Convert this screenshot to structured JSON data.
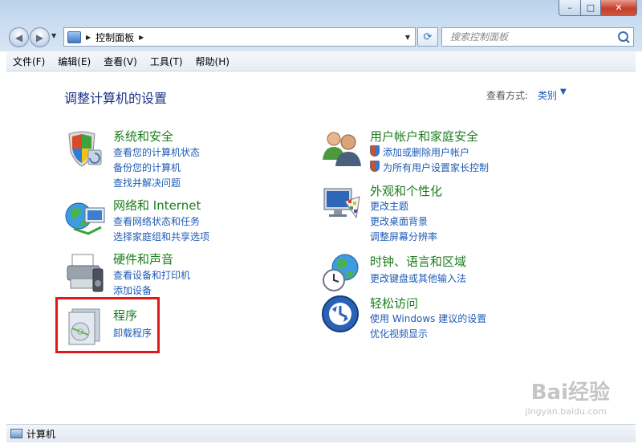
{
  "window": {
    "caption": {
      "minimize": "–",
      "maximize": "□",
      "close": "✕"
    }
  },
  "nav": {
    "back_glyph": "◀",
    "forward_glyph": "▶"
  },
  "address": {
    "path": "控制面板",
    "refresh_glyph": "⟳"
  },
  "search": {
    "placeholder": "搜索控制面板"
  },
  "menu": [
    "文件(F)",
    "编辑(E)",
    "查看(V)",
    "工具(T)",
    "帮助(H)"
  ],
  "main": {
    "title": "调整计算机的设置",
    "view_by_label": "查看方式:",
    "view_by_value": "类别"
  },
  "categories": [
    {
      "title": "系统和安全",
      "icon": "shield-icon",
      "links": [
        "查看您的计算机状态",
        "备份您的计算机",
        "查找并解决问题"
      ]
    },
    {
      "title": "网络和 Internet",
      "icon": "globe-network-icon",
      "links": [
        "查看网络状态和任务",
        "选择家庭组和共享选项"
      ]
    },
    {
      "title": "硬件和声音",
      "icon": "printer-icon",
      "links": [
        "查看设备和打印机",
        "添加设备"
      ]
    },
    {
      "title": "程序",
      "icon": "programs-icon",
      "links": [
        "卸载程序"
      ]
    },
    {
      "title": "用户帐户和家庭安全",
      "icon": "users-icon",
      "links": [
        "添加或删除用户帐户",
        "为所有用户设置家长控制"
      ]
    },
    {
      "title": "外观和个性化",
      "icon": "monitor-palette-icon",
      "links": [
        "更改主题",
        "更改桌面背景",
        "调整屏幕分辨率"
      ]
    },
    {
      "title": "时钟、语言和区域",
      "icon": "clock-globe-icon",
      "links": [
        "更改键盘或其他输入法"
      ]
    },
    {
      "title": "轻松访问",
      "icon": "ease-of-access-icon",
      "links": [
        "使用 Windows 建议的设置",
        "优化视频显示"
      ]
    }
  ],
  "status": {
    "text": "计算机"
  },
  "watermark": {
    "main": "Bai经验",
    "sub": "jingyan.baidu.com"
  },
  "colors": {
    "link": "#1e5bb4",
    "category": "#1c7d1c",
    "title": "#1e3287",
    "highlight": "#e01818"
  }
}
